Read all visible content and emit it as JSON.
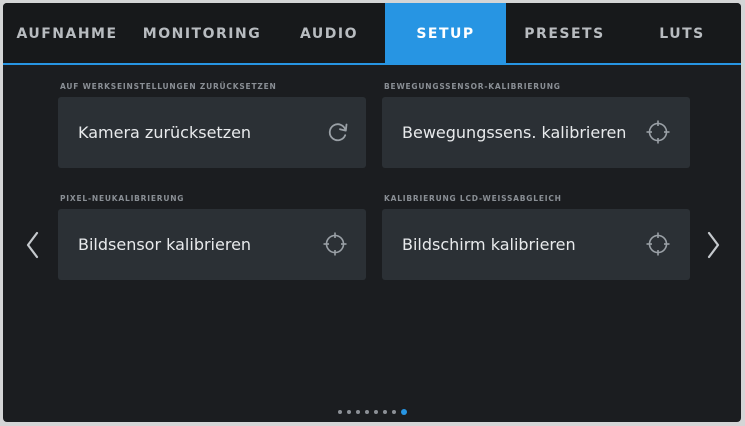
{
  "tabs": [
    {
      "label": "AUFNAHME",
      "active": false
    },
    {
      "label": "MONITORING",
      "active": false
    },
    {
      "label": "AUDIO",
      "active": false
    },
    {
      "label": "SETUP",
      "active": true
    },
    {
      "label": "PRESETS",
      "active": false
    },
    {
      "label": "LUTS",
      "active": false
    }
  ],
  "sections": [
    {
      "label": "AUF WERKSEINSTELLUNGEN ZURÜCKSETZEN",
      "button": "Kamera zurücksetzen",
      "icon": "reset-icon"
    },
    {
      "label": "BEWEGUNGSSENSOR-KALIBRIERUNG",
      "button": "Bewegungssens. kalibrieren",
      "icon": "crosshair-icon"
    },
    {
      "label": "PIXEL-NEUKALIBRIERUNG",
      "button": "Bildsensor kalibrieren",
      "icon": "crosshair-icon"
    },
    {
      "label": "KALIBRIERUNG LCD-WEISSABGLEICH",
      "button": "Bildschirm kalibrieren",
      "icon": "crosshair-icon"
    }
  ],
  "navigation": {
    "prev": "chevron-left-icon",
    "next": "chevron-right-icon"
  },
  "pagination": {
    "total_pages": 8,
    "current_page": 8
  },
  "colors": {
    "accent": "#2795e3",
    "background": "#1b1d20",
    "card": "#2b3035",
    "text": "#e8eaec"
  }
}
